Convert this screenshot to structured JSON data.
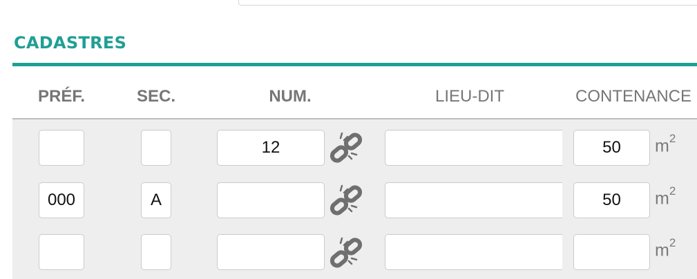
{
  "section": {
    "title": "CADASTRES"
  },
  "columns": [
    {
      "key": "pref",
      "label": "PRÉF."
    },
    {
      "key": "sec",
      "label": "SEC."
    },
    {
      "key": "num",
      "label": "NUM."
    },
    {
      "key": "lieu",
      "label": "LIEU-DIT"
    },
    {
      "key": "cont",
      "label": "CONTENANCE"
    }
  ],
  "rows": [
    {
      "pref": "",
      "sec": "",
      "num": "12",
      "lieu": "",
      "cont": "50",
      "unit_base": "m",
      "unit_exp": "2"
    },
    {
      "pref": "000",
      "sec": "A",
      "num": "",
      "lieu": "",
      "cont": "50",
      "unit_base": "m",
      "unit_exp": "2"
    },
    {
      "pref": "",
      "sec": "",
      "num": "",
      "lieu": "",
      "cont": "",
      "unit_base": "m",
      "unit_exp": "2"
    }
  ],
  "icons": {
    "unlink": "broken-link-icon"
  },
  "colors": {
    "accent": "#1f9f94",
    "header_text": "#767676",
    "rows_background": "#efeeee"
  }
}
